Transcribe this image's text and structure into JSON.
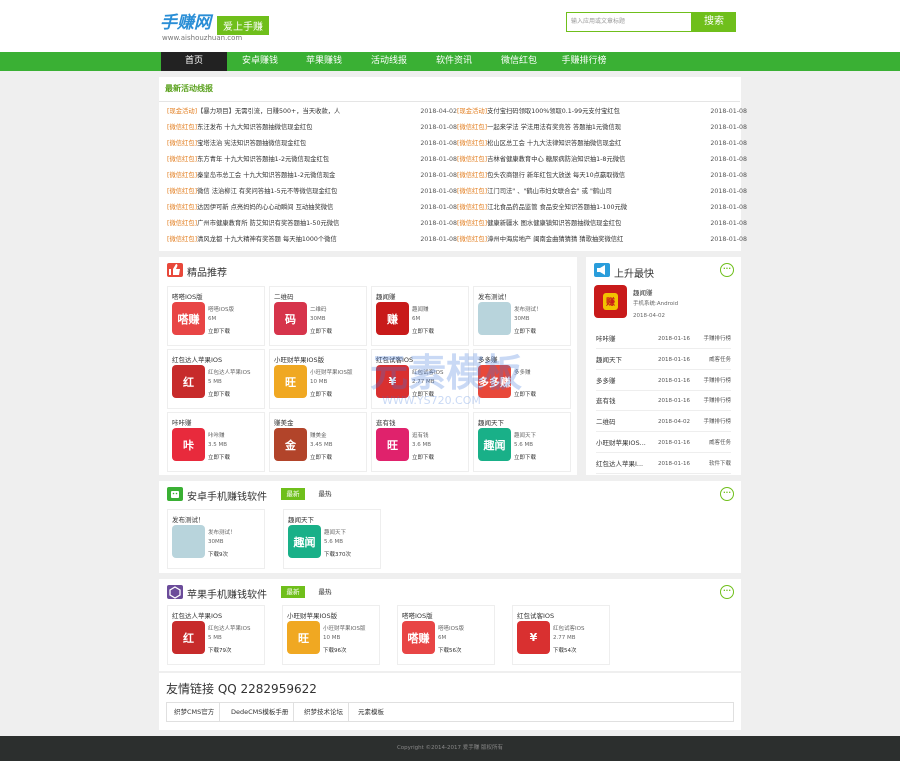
{
  "header": {
    "logo_main": "手赚网",
    "logo_slogan": "爱上手赚",
    "logo_domain": "www.aishouzhuan.com",
    "search_placeholder": "输入应用或文章标题",
    "search_button": "搜索"
  },
  "nav": [
    "首页",
    "安卓赚钱",
    "苹果赚钱",
    "活动线报",
    "软件资讯",
    "微信红包",
    "手赚排行榜"
  ],
  "news": {
    "title": "最新活动线报",
    "left": [
      {
        "tag": "[现金活动]",
        "text": "【暴力项目】无需引流，日赚500+，当天收款，人",
        "date": "2018-04-02"
      },
      {
        "tag": "[微信红包]",
        "text": "东汪发布 十九大知识答题抽微信现金红包",
        "date": "2018-01-08"
      },
      {
        "tag": "[微信红包]",
        "text": "宝塔法治 宪法知识答题抽微信现金红包",
        "date": "2018-01-08"
      },
      {
        "tag": "[微信红包]",
        "text": "东方青年 十九大知识答题抽1-2元微信现金红包",
        "date": "2018-01-08"
      },
      {
        "tag": "[微信红包]",
        "text": "秦皇岛市总工会 十九大知识答题抽1-2元微信现金",
        "date": "2018-01-08"
      },
      {
        "tag": "[微信红包]",
        "text": "微信 法治柳江 有奖问答抽1-5元不等微信现金红包",
        "date": "2018-01-08"
      },
      {
        "tag": "[微信红包]",
        "text": "达因伊可新 点亮妈妈的心心动瞬间 互动抽奖微信",
        "date": "2018-01-08"
      },
      {
        "tag": "[微信红包]",
        "text": "广州市健康教育所 防艾知识有奖答题抽1-50元微信",
        "date": "2018-01-08"
      },
      {
        "tag": "[微信红包]",
        "text": "清风龙都 十九大精神有奖答题 每天抽1000个微信",
        "date": "2018-01-08"
      }
    ],
    "right": [
      {
        "tag": "[现金活动]",
        "text": "支付宝扫码领取100%领取0.1-99元支付宝红包",
        "date": "2018-01-08"
      },
      {
        "tag": "[微信红包]",
        "text": "一起来学法 学法用法有奖竞答 答题抽1元微信现",
        "date": "2018-01-08"
      },
      {
        "tag": "[微信红包]",
        "text": "松山区总工会 十九大法律知识答题抽微信现金红",
        "date": "2018-01-08"
      },
      {
        "tag": "[微信红包]",
        "text": "吉林省健康教育中心 糖尿病防治知识抽1-8元微信",
        "date": "2018-01-08"
      },
      {
        "tag": "[微信红包]",
        "text": "包头农商银行 新年红包大放送 每天10点赢取微信",
        "date": "2018-01-08"
      },
      {
        "tag": "[微信红包]",
        "text": "江门司法\" 、\"鹤山市妇女联合会\" 或 \"鹤山司",
        "date": "2018-01-08"
      },
      {
        "tag": "[微信红包]",
        "text": "江北食品药品监管 食品安全知识答题抽1-100元微",
        "date": "2018-01-08"
      },
      {
        "tag": "[微信红包]",
        "text": "健康新疆水 图水健康镇知识答题抽微信现金红包",
        "date": "2018-01-08"
      },
      {
        "tag": "[微信红包]",
        "text": "漳州中海房地产 闽南金曲猜猜猜 猜歌抽奖微信红",
        "date": "2018-01-08"
      }
    ]
  },
  "featured": {
    "title": "精品推荐",
    "cards": [
      {
        "name": "嗒嗒IOS版",
        "sub": "嗒嗒IOS版",
        "size": "6M",
        "dl": "立即下载",
        "icon": "嗒赚",
        "color": "#e84545"
      },
      {
        "name": "二维码",
        "sub": "二维码",
        "size": "30MB",
        "dl": "立即下载",
        "icon": "码",
        "color": "#d6344b"
      },
      {
        "name": "趣闻赚",
        "sub": "趣闻赚",
        "size": "6M",
        "dl": "立即下载",
        "icon": "赚",
        "color": "#c81a1a"
      },
      {
        "name": "发布测试！",
        "sub": "发布测试！",
        "size": "30MB",
        "dl": "立即下载",
        "icon": "",
        "color": "#b8d4dc"
      },
      {
        "name": "红包达人苹果IOS",
        "sub": "红包达人苹果IOS",
        "size": "5 MB",
        "dl": "立即下载",
        "icon": "红",
        "color": "#c72b2b"
      },
      {
        "name": "小旺财苹果IOS版",
        "sub": "小旺财苹果IOS版",
        "size": "10 MB",
        "dl": "立即下载",
        "icon": "旺",
        "color": "#f0a822"
      },
      {
        "name": "红包试客IOS",
        "sub": "红包试客IOS",
        "size": "2.77 MB",
        "dl": "立即下载",
        "icon": "¥",
        "color": "#d93030"
      },
      {
        "name": "多多赚",
        "sub": "多多赚",
        "size": "",
        "dl": "立即下载",
        "icon": "多多赚",
        "color": "#e8483a"
      },
      {
        "name": "咔咔赚",
        "sub": "咔咔赚",
        "size": "3.5 MB",
        "dl": "立即下载",
        "icon": "咔",
        "color": "#e82a3c"
      },
      {
        "name": "赚美金",
        "sub": "赚美金",
        "size": "3.45 MB",
        "dl": "立即下载",
        "icon": "金",
        "color": "#b2442a"
      },
      {
        "name": "逛有钱",
        "sub": "逛有钱",
        "size": "3.6 MB",
        "dl": "立即下载",
        "icon": "旺",
        "color": "#e0226c"
      },
      {
        "name": "趣闻天下",
        "sub": "趣闻天下",
        "size": "5.6 MB",
        "dl": "立即下载",
        "icon": "趣闻",
        "color": "#19b088"
      }
    ]
  },
  "rank": {
    "title": "上升最快",
    "top": {
      "name": "趣闻赚",
      "system": "手机系统:Android",
      "date": "2018-04-02",
      "icon": "赚"
    },
    "rows": [
      {
        "name": "咔咔赚",
        "date": "2018-01-16",
        "cat": "手赚排行榜"
      },
      {
        "name": "趣闻天下",
        "date": "2018-01-16",
        "cat": "威客任务"
      },
      {
        "name": "多多赚",
        "date": "2018-01-16",
        "cat": "手赚排行榜"
      },
      {
        "name": "逛有钱",
        "date": "2018-01-16",
        "cat": "手赚排行榜"
      },
      {
        "name": "二维码",
        "date": "2018-04-02",
        "cat": "手赚排行榜"
      },
      {
        "name": "小旺财苹果IOS...",
        "date": "2018-01-16",
        "cat": "威客任务"
      },
      {
        "name": "红包达人苹果I...",
        "date": "2018-01-16",
        "cat": "软件下载"
      }
    ]
  },
  "android": {
    "title": "安卓手机赚钱软件",
    "tab_new": "最新",
    "tab_hot": "最热",
    "cards": [
      {
        "name": "发布测试！",
        "sub": "发布测试！",
        "size": "30MB",
        "dl": "下载9次",
        "icon": "",
        "color": "#b8d4dc"
      },
      {
        "name": "趣闻天下",
        "sub": "趣闻天下",
        "size": "5.6 MB",
        "dl": "下载370次",
        "icon": "趣闻",
        "color": "#19b088"
      }
    ]
  },
  "apple": {
    "title": "苹果手机赚钱软件",
    "tab_new": "最新",
    "tab_hot": "最热",
    "cards": [
      {
        "name": "红包达人苹果IOS",
        "sub": "红包达人苹果IOS",
        "size": "5 MB",
        "dl": "下载79次",
        "icon": "红",
        "color": "#c72b2b"
      },
      {
        "name": "小旺财苹果IOS版",
        "sub": "小旺财苹果IOS版",
        "size": "10 MB",
        "dl": "下载96次",
        "icon": "旺",
        "color": "#f0a822"
      },
      {
        "name": "嗒嗒IOS版",
        "sub": "嗒嗒IOS版",
        "size": "6M",
        "dl": "下载56次",
        "icon": "嗒赚",
        "color": "#e84545"
      },
      {
        "name": "红包试客IOS",
        "sub": "红包试客IOS",
        "size": "2.77 MB",
        "dl": "下载54次",
        "icon": "¥",
        "color": "#d93030"
      }
    ]
  },
  "links": {
    "title": "友情链接 QQ 2282959622",
    "items": [
      "织梦CMS官方",
      "DedeCMS模板手册",
      "织梦技术论坛",
      "元素模板"
    ]
  },
  "footer": "Copyright ©2014-2017 爱手赚 版权所有",
  "watermark": {
    "main": "元素模板",
    "sub": "WWW.YS720.COM"
  }
}
